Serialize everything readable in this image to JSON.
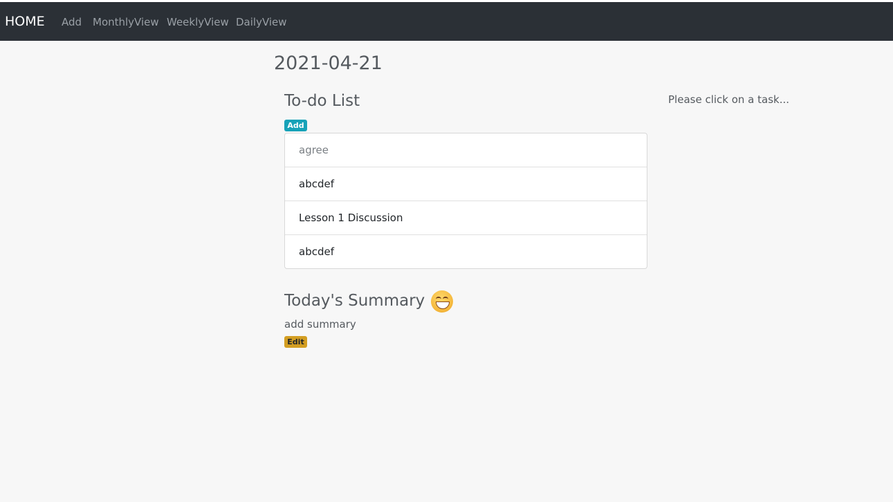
{
  "navbar": {
    "brand": "HOME",
    "links": [
      "Add",
      "MonthlyView",
      "WeeklyView",
      "DailyView"
    ]
  },
  "page": {
    "date": "2021-04-21"
  },
  "todo": {
    "title": "To-do List",
    "add_label": "Add",
    "items": [
      {
        "text": "agree",
        "done": true
      },
      {
        "text": "abcdef",
        "done": false
      },
      {
        "text": "Lesson 1 Discussion",
        "done": false
      },
      {
        "text": "abcdef",
        "done": false
      }
    ]
  },
  "summary": {
    "title": "Today's Summary",
    "mood_icon": "grinning-face-icon",
    "text": "add summary",
    "edit_label": "Edit"
  },
  "detail": {
    "hint": "Please click on a task..."
  },
  "colors": {
    "navbar_bg": "#2b3036",
    "add_badge": "#17a2b8",
    "edit_badge": "#d39e22",
    "page_bg": "#f7f7f7"
  }
}
